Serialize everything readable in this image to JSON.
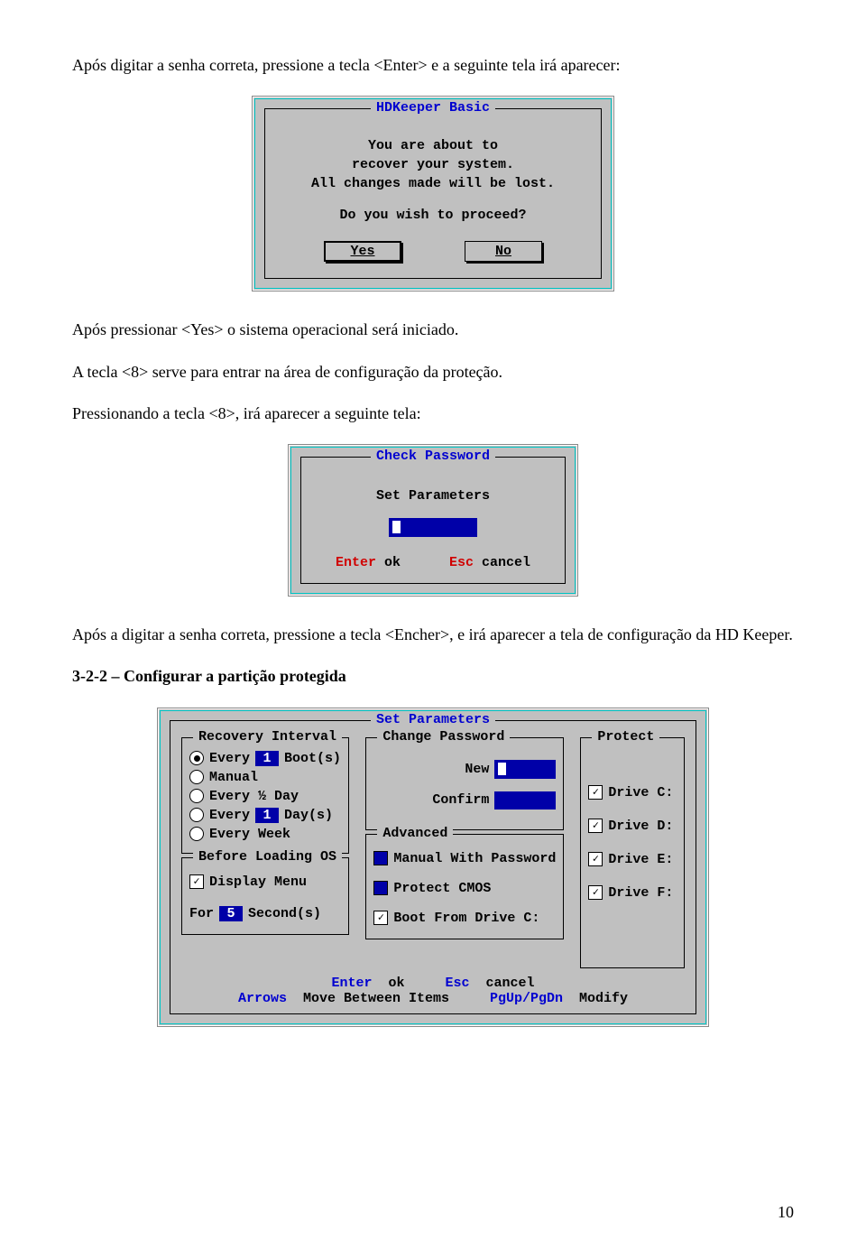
{
  "para": {
    "p1": "Após digitar a senha correta, pressione a tecla <Enter> e a seguinte tela irá aparecer:",
    "p2": "Após pressionar <Yes> o sistema operacional será iniciado.",
    "p3": "A tecla <8> serve para entrar na área de configuração da proteção.",
    "p4": "Pressionando a tecla <8>, irá aparecer a seguinte tela:",
    "p5": "Após a digitar a senha correta, pressione a tecla <Encher>, e irá aparecer a tela de configuração da HD Keeper.",
    "h322": "3-2-2 – Configurar a partição protegida"
  },
  "dlg1": {
    "title": "HDKeeper Basic",
    "l1": "You are about to",
    "l2": "recover your system.",
    "l3": "All changes made will be lost.",
    "l4": "Do you wish to proceed?",
    "yes": "Yes",
    "no": "No"
  },
  "dlg2": {
    "title": "Check Password",
    "sub": "Set Parameters",
    "enter": "Enter",
    "ok": "ok",
    "esc": "Esc",
    "cancel": "cancel"
  },
  "dlg3": {
    "title": "Set Parameters",
    "recovery": {
      "title": "Recovery Interval",
      "opt1a": "Every",
      "opt1val": "1",
      "opt1b": "Boot(s)",
      "opt2": "Manual",
      "opt3": "Every ½ Day",
      "opt4a": "Every",
      "opt4val": "1",
      "opt4b": "Day(s)",
      "opt5": "Every Week"
    },
    "before": {
      "title": "Before Loading OS",
      "display": "Display Menu",
      "for": "For",
      "forval": "5",
      "seconds": "Second(s)"
    },
    "changepw": {
      "title": "Change Password",
      "new": "New",
      "confirm": "Confirm"
    },
    "advanced": {
      "title": "Advanced",
      "a1": "Manual With Password",
      "a2": "Protect CMOS",
      "a3": "Boot From Drive C:"
    },
    "protect": {
      "title": "Protect",
      "c": "Drive C:",
      "d": "Drive D:",
      "e": "Drive E:",
      "f": "Drive F:"
    },
    "footer": {
      "enter": "Enter",
      "ok": "ok",
      "esc": "Esc",
      "cancel": "cancel",
      "arrows": "Arrows",
      "move": "Move Between Items",
      "pg": "PgUp/PgDn",
      "modify": "Modify"
    }
  },
  "page_number": "10"
}
